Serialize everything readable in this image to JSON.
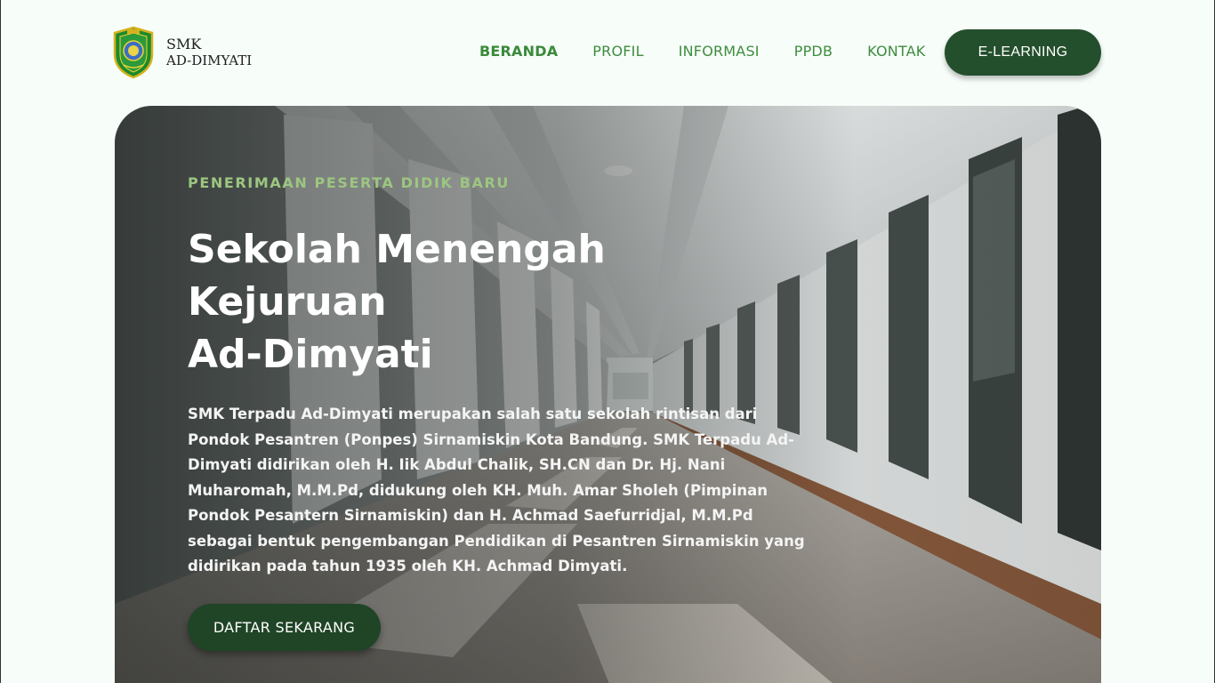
{
  "brand": {
    "line1": "SMK",
    "line2": "AD-DIMYATI",
    "emblem_icon": "school-emblem-icon"
  },
  "nav": {
    "items": [
      {
        "label": "BERANDA",
        "active": true
      },
      {
        "label": "PROFIL",
        "active": false
      },
      {
        "label": "INFORMASI",
        "active": false
      },
      {
        "label": "PPDB",
        "active": false
      },
      {
        "label": "KONTAK",
        "active": false
      }
    ],
    "cta_label": "E-LEARNING"
  },
  "hero": {
    "eyebrow": "PENERIMAAN PESERTA DIDIK BARU",
    "title_lines": [
      "Sekolah Menengah",
      "Kejuruan",
      "Ad-Dimyati"
    ],
    "description": "SMK Terpadu Ad-Dimyati merupakan salah satu sekolah rintisan dari Pondok Pesantren (Ponpes) Sirnamiskin Kota Bandung. SMK Terpadu Ad-Dimyati didirikan oleh H. Iik Abdul Chalik, SH.CN dan Dr. Hj. Nani Muharomah, M.M.Pd, didukung oleh KH. Muh. Amar Sholeh (Pimpinan Pondok Pesantern Sirnamiskin) dan H. Achmad Saefurridjal, M.M.Pd sebagai bentuk pengembangan Pendidikan di Pesantren Sirnamiskin yang didirikan pada tahun 1935 oleh KH. Achmad Dimyati.",
    "cta_label": "DAFTAR SEKARANG"
  },
  "colors": {
    "primary_dark_green": "#244f2c",
    "nav_green": "#3e8d3f",
    "eyebrow_green": "#9cc680",
    "page_bg": "#f7fdf9"
  }
}
